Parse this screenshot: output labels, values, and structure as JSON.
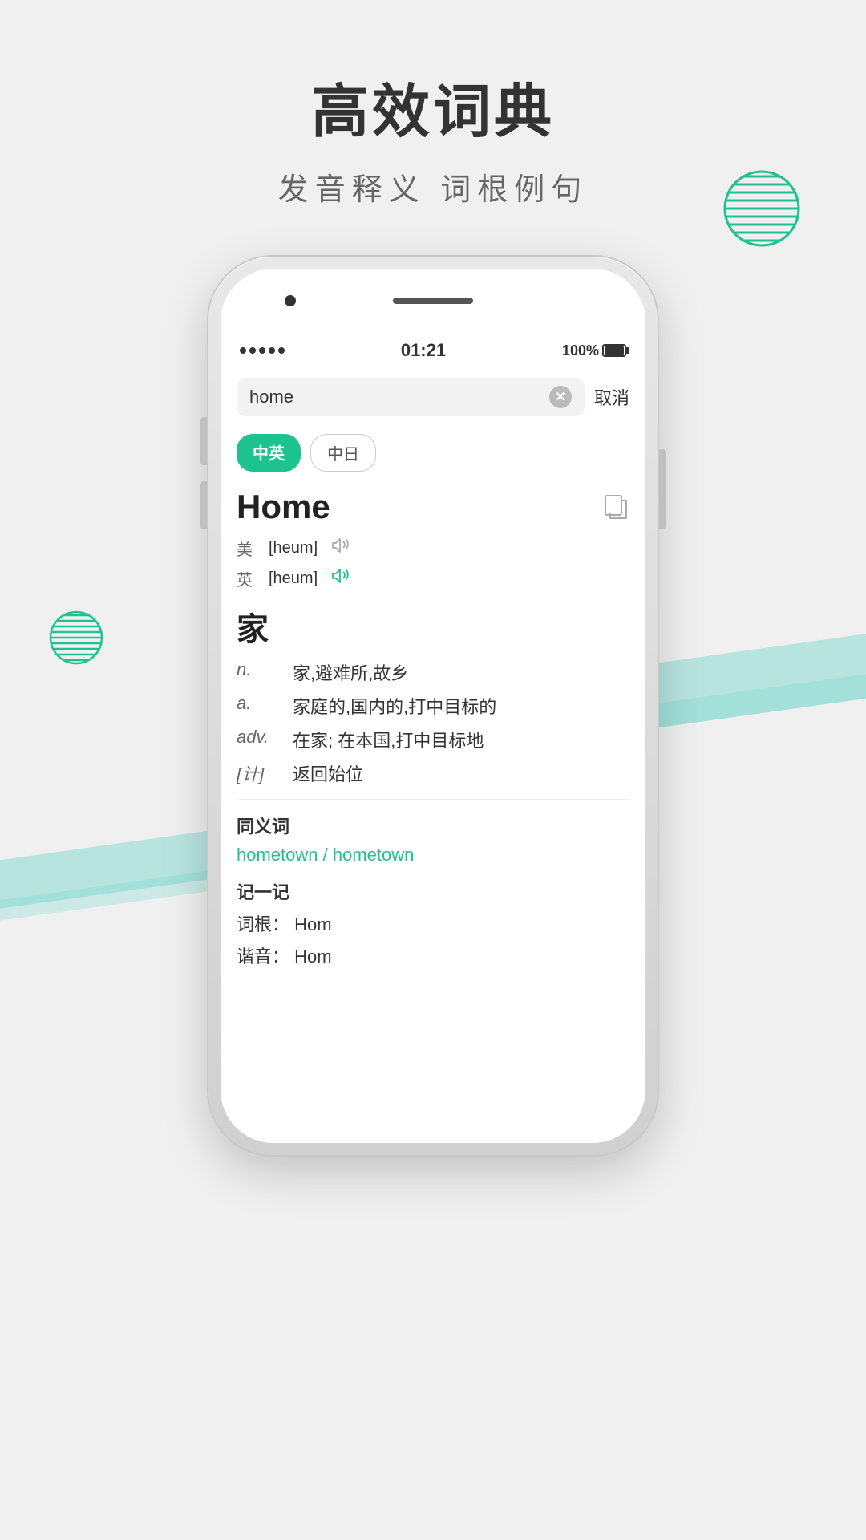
{
  "page": {
    "title": "高效词典",
    "subtitle": "发音释义  词根例句"
  },
  "phone": {
    "status_bar": {
      "signals": [
        "●",
        "●",
        "●",
        "●",
        "●"
      ],
      "time": "01:21",
      "battery": "100%"
    },
    "search": {
      "query": "home",
      "cancel_label": "取消"
    },
    "tabs": [
      {
        "id": "zh-en",
        "label": "中英",
        "active": true
      },
      {
        "id": "zh-ja",
        "label": "中日",
        "active": false
      }
    ],
    "word": {
      "title": "Home",
      "pronunciations": [
        {
          "region": "美",
          "phonetic": "[heum]",
          "active": false
        },
        {
          "region": "英",
          "phonetic": "[heum]",
          "active": true
        }
      ],
      "chinese": "家",
      "definitions": [
        {
          "type": "n.",
          "text": "家,避难所,故乡"
        },
        {
          "type": "a.",
          "text": "家庭的,国内的,打中目标的"
        },
        {
          "type": "adv.",
          "text": "在家; 在本国,打中目标地"
        },
        {
          "type": "[计]",
          "text": "返回始位"
        }
      ],
      "synonyms_label": "同义词",
      "synonyms": "hometown / hometown",
      "memory_label": "记一记",
      "word_root_label": "词根：",
      "word_root": "Hom",
      "homophone_label": "谐音：",
      "homophone": "Hom"
    }
  }
}
